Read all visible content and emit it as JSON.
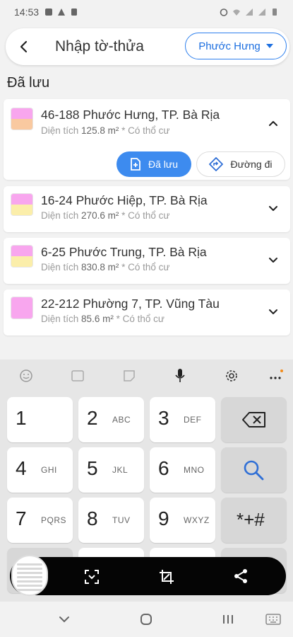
{
  "status_bar": {
    "time": "14:53"
  },
  "header": {
    "title": "Nhập tờ-thửa",
    "district": "Phước Hưng"
  },
  "section_title": "Đã lưu",
  "cards": [
    {
      "title": "46-188 Phước Hưng, TP. Bà Rịa",
      "sub_prefix": "Diện tích",
      "area": "125.8 m²",
      "sub_suffix": "* Có thổ cư",
      "swatch_bottom": "#f9c9a0",
      "expanded": true
    },
    {
      "title": "16-24 Phước Hiệp, TP. Bà Rịa",
      "sub_prefix": "Diện tích",
      "area": "270.6 m²",
      "sub_suffix": "* Có thổ cư",
      "swatch_bottom": "#fbeeaa",
      "expanded": false
    },
    {
      "title": "6-25 Phước Trung, TP. Bà Rịa",
      "sub_prefix": "Diện tích",
      "area": "830.8 m²",
      "sub_suffix": "* Có thổ cư",
      "swatch_bottom": "#fbeeaa",
      "expanded": false
    },
    {
      "title": "22-212 Phường 7, TP. Vũng Tàu",
      "sub_prefix": "Diện tích",
      "area": "85.6 m²",
      "sub_suffix": "* Có thổ cư",
      "swatch_bottom": "#f8a6ee",
      "expanded": false
    }
  ],
  "card_actions": {
    "saved_label": "Đã lưu",
    "route_label": "Đường đi"
  },
  "keyboard": {
    "keys": [
      {
        "num": "1",
        "letters": ""
      },
      {
        "num": "2",
        "letters": "ABC"
      },
      {
        "num": "3",
        "letters": "DEF"
      },
      {
        "num": "4",
        "letters": "GHI"
      },
      {
        "num": "5",
        "letters": "JKL"
      },
      {
        "num": "6",
        "letters": "MNO"
      },
      {
        "num": "7",
        "letters": "PQRS"
      },
      {
        "num": "8",
        "letters": "TUV"
      },
      {
        "num": "9",
        "letters": "WXYZ"
      }
    ],
    "symbols_label": "*+#"
  },
  "colors": {
    "accent": "#3d8bef",
    "swatch_top": "#f8a6ee"
  }
}
